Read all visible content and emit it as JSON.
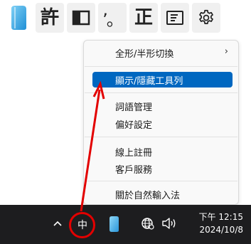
{
  "toolbar": {
    "buttons": [
      {
        "icon": "natural-input-logo-icon"
      },
      {
        "label": "許"
      },
      {
        "icon": "half-width-toggle-icon"
      },
      {
        "label": "’。"
      },
      {
        "label": "正"
      },
      {
        "icon": "document-list-icon"
      },
      {
        "icon": "gear-icon"
      }
    ]
  },
  "menu": {
    "items": [
      {
        "label": "全形/半形切換",
        "submenu_arrow": "›"
      },
      {
        "label": "顯示/隱藏工具列",
        "highlighted": true
      },
      {
        "label": "詞語管理"
      },
      {
        "label": "偏好設定"
      },
      {
        "label": "線上註冊"
      },
      {
        "label": "客戶服務"
      },
      {
        "label": "關於自然輸入法"
      }
    ]
  },
  "taskbar": {
    "ime_indicator": "中",
    "clock": {
      "time": "下午 12:15",
      "date": "2024/10/8"
    }
  },
  "colors": {
    "highlight": "#0067c0",
    "annotation_red": "#e30000",
    "taskbar_bg": "#1d1d1f"
  }
}
